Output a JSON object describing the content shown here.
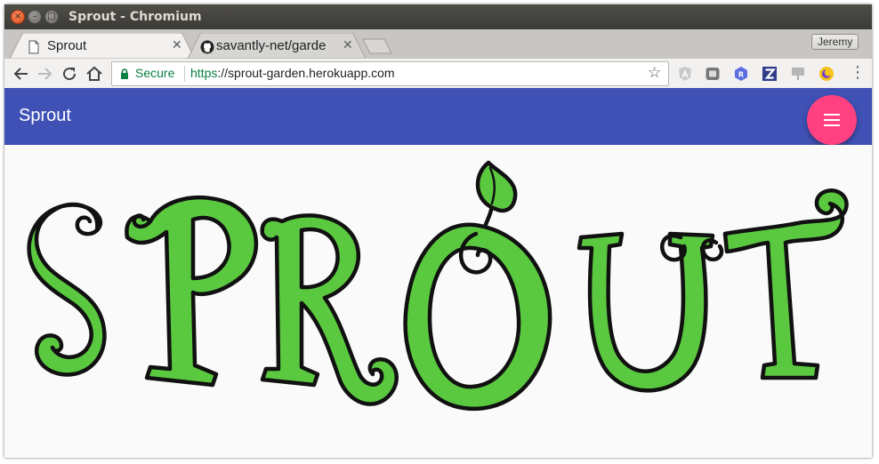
{
  "window": {
    "title": "Sprout - Chromium"
  },
  "tabs": [
    {
      "label": "Sprout",
      "icon": "page-icon",
      "active": true
    },
    {
      "label": "savantly-net/garde",
      "icon": "github-icon",
      "active": false
    }
  ],
  "profile": {
    "name": "Jeremy"
  },
  "omnibox": {
    "security_label": "Secure",
    "url_scheme": "https",
    "url_rest": "://sprout-garden.herokuapp.com"
  },
  "extensions": [
    "angular-icon",
    "pocket-icon",
    "r-extension-icon",
    "zotero-icon",
    "presentation-icon",
    "moon-icon"
  ],
  "app": {
    "title": "Sprout",
    "menu_icon": "hamburger-menu-icon"
  },
  "logo": {
    "text": "SPROUT"
  },
  "colors": {
    "app_bar": "#3f51b5",
    "fab": "#ff4081",
    "logo_fill": "#5bc940",
    "logo_outline": "#111111",
    "secure_green": "#0b8043"
  }
}
